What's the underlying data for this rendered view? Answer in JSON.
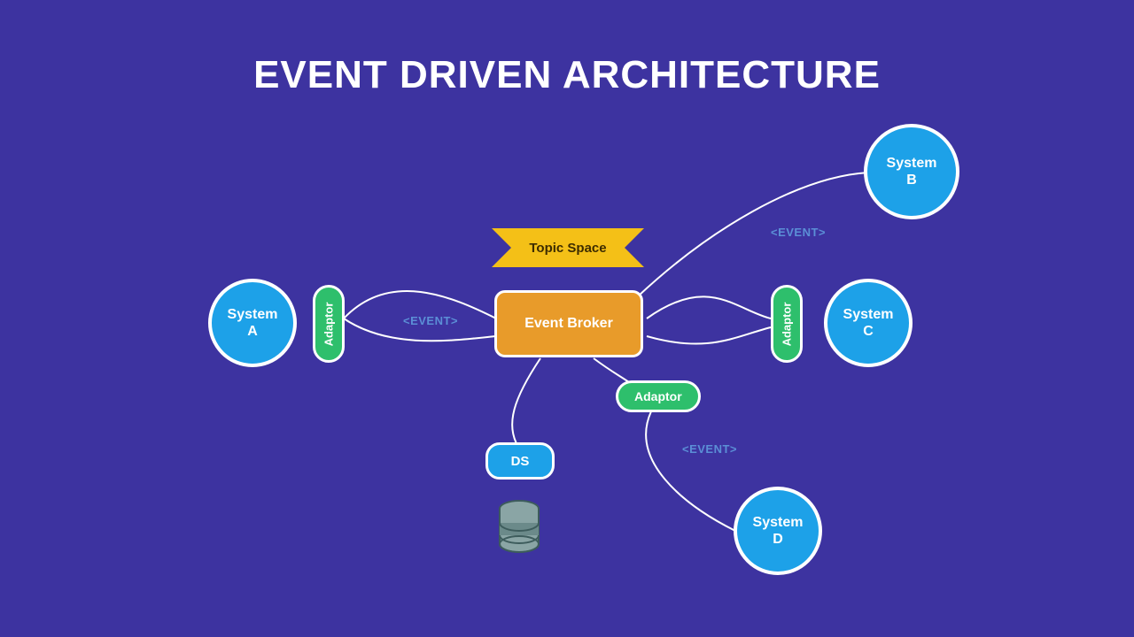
{
  "title": "EVENT DRIVEN ARCHITECTURE",
  "nodes": {
    "system_a": "System\nA",
    "system_b": "System\nB",
    "system_c": "System\nC",
    "system_d": "System\nD",
    "broker": "Event Broker",
    "topic": "Topic Space",
    "ds": "DS",
    "adaptor_a": "Adaptor",
    "adaptor_c": "Adaptor",
    "adaptor_d": "Adaptor"
  },
  "labels": {
    "event1": "<EVENT>",
    "event2": "<EVENT>",
    "event3": "<EVENT>"
  },
  "colors": {
    "bg": "#3d33a0",
    "circle": "#1da1e8",
    "adaptor": "#2ebf6c",
    "broker": "#e89b2a",
    "topic": "#f4c017",
    "ds": "#1da1e8",
    "event_text": "#5b8fd6"
  }
}
